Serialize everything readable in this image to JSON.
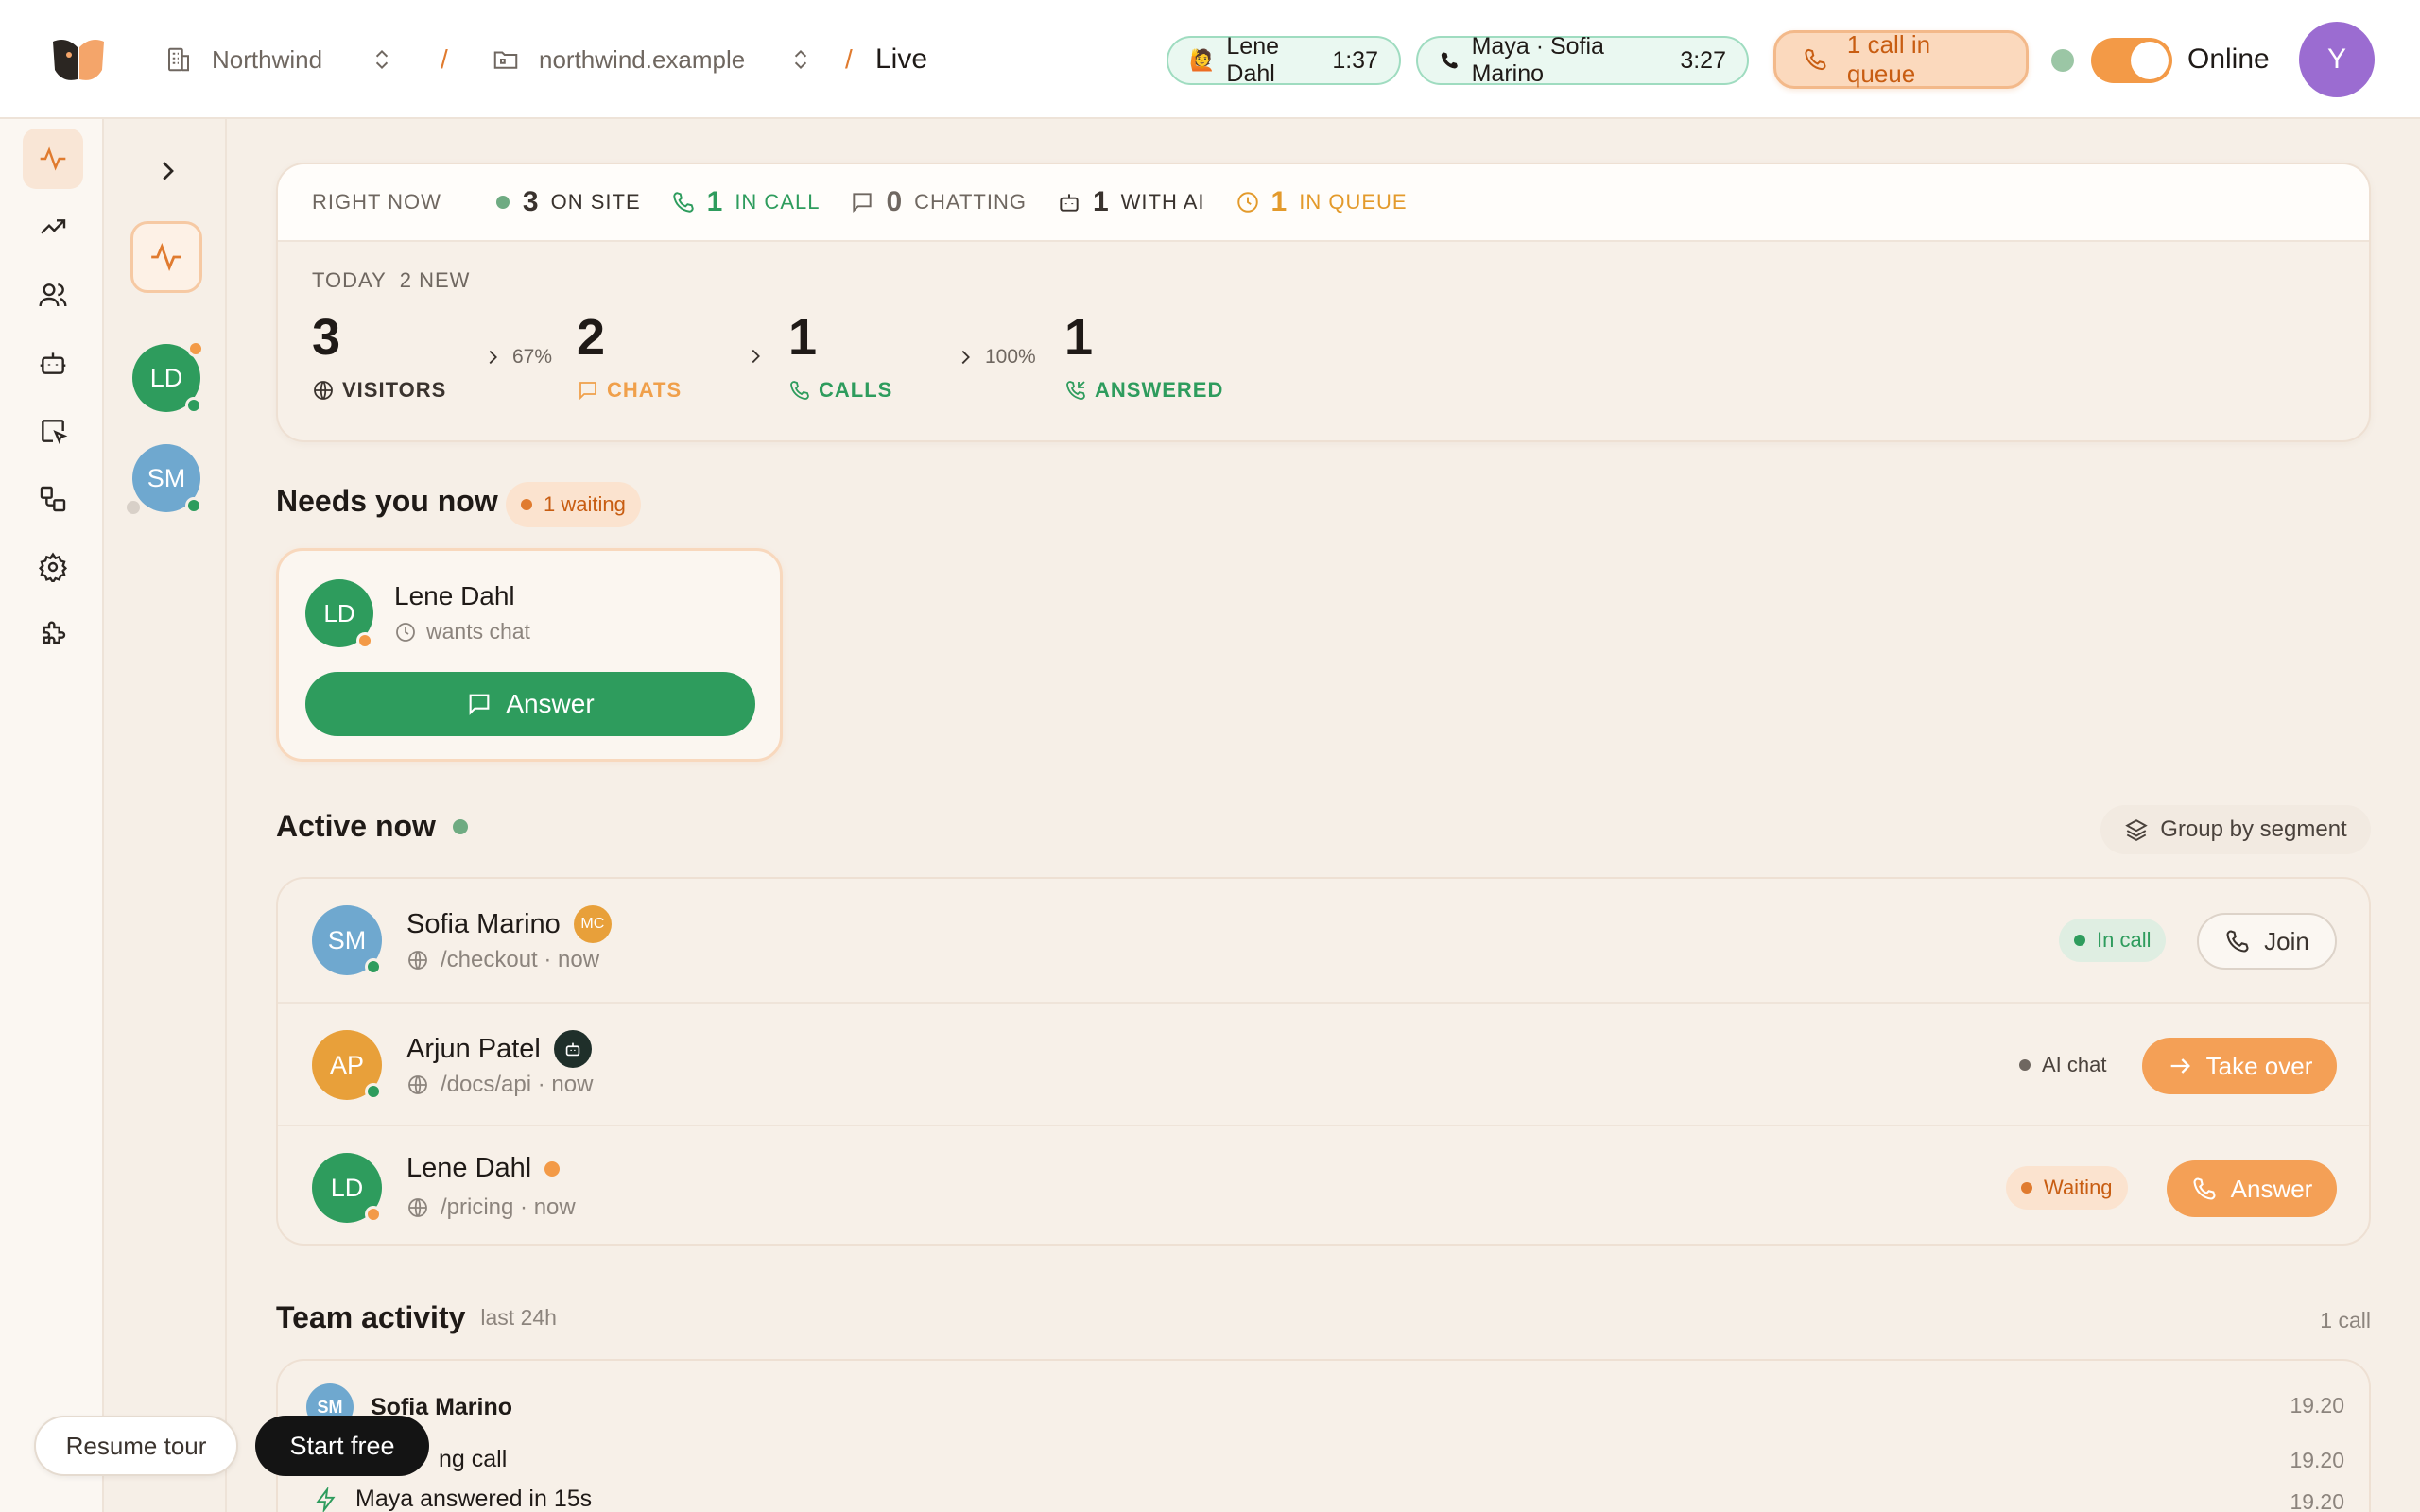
{
  "topbar": {
    "org": "Northwind",
    "site": "northwind.example",
    "page": "Live",
    "slash": "/",
    "pills": [
      {
        "emoji": "🙋",
        "label": "Lene Dahl",
        "time": "1:37"
      },
      {
        "label": "Maya · Sofia Marino",
        "time": "3:27"
      }
    ],
    "queue": "1 call in queue",
    "status": "Online",
    "user_initial": "Y"
  },
  "rail": [
    "live",
    "trends",
    "people",
    "bot",
    "forms",
    "flows",
    "settings",
    "integrations"
  ],
  "sub": {
    "avatars": [
      {
        "initials": "LD",
        "color": "#2e9c5d"
      },
      {
        "initials": "SM",
        "color": "#6fa8cf"
      }
    ]
  },
  "right_now": {
    "label": "Right now",
    "items": [
      {
        "value": "3",
        "label": "On site",
        "color": "#3a332e",
        "icon": "dot"
      },
      {
        "value": "1",
        "label": "In call",
        "color": "#2e9c5d",
        "icon": "phone"
      },
      {
        "value": "0",
        "label": "Chatting",
        "color": "#6f6760",
        "icon": "chat"
      },
      {
        "value": "1",
        "label": "With AI",
        "color": "#3a332e",
        "icon": "bot"
      },
      {
        "value": "1",
        "label": "In queue",
        "color": "#e39a2b",
        "icon": "clock"
      }
    ]
  },
  "today": {
    "label": "TODAY",
    "new": "2 NEW",
    "funnel": [
      {
        "value": "3",
        "label": "Visitors",
        "color": "#3a332e",
        "icon": "globe"
      },
      {
        "value": "2",
        "label": "Chats",
        "color": "#f0a04b",
        "icon": "chat"
      },
      {
        "value": "1",
        "label": "Calls",
        "color": "#2e9c5d",
        "icon": "phone"
      },
      {
        "value": "1",
        "label": "Answered",
        "color": "#2e9c5d",
        "icon": "phone-in"
      }
    ],
    "rates": [
      "67%",
      "",
      "100%"
    ]
  },
  "needs": {
    "title": "Needs you now",
    "badge": "1 waiting",
    "card": {
      "initials": "LD",
      "name": "Lene Dahl",
      "status": "wants chat",
      "button": "Answer"
    }
  },
  "active": {
    "title": "Active now",
    "group": "Group by segment",
    "rows": [
      {
        "initials": "SM",
        "color": "#6fa8cf",
        "name": "Sofia Marino",
        "badge": "MC",
        "page": "/checkout · now",
        "tag": "In call",
        "action": "Join"
      },
      {
        "initials": "AP",
        "color": "#e8a03a",
        "name": "Arjun Patel",
        "page": "/docs/api · now",
        "tag": "AI chat",
        "action": "Take over"
      },
      {
        "initials": "LD",
        "color": "#2e9c5d",
        "name": "Lene Dahl",
        "page": "/pricing · now",
        "tag": "Waiting",
        "action": "Answer"
      }
    ]
  },
  "team": {
    "title": "Team activity",
    "range": "last 24h",
    "count": "1 call",
    "lines": [
      {
        "text": "Sofia Marino",
        "avatar": "SM",
        "time": "19.20"
      },
      {
        "text": "ng call",
        "time": "19.20"
      },
      {
        "text": "Maya answered in 15s",
        "time": "19.20"
      }
    ]
  },
  "footer": {
    "resume": "Resume tour",
    "start": "Start free"
  }
}
